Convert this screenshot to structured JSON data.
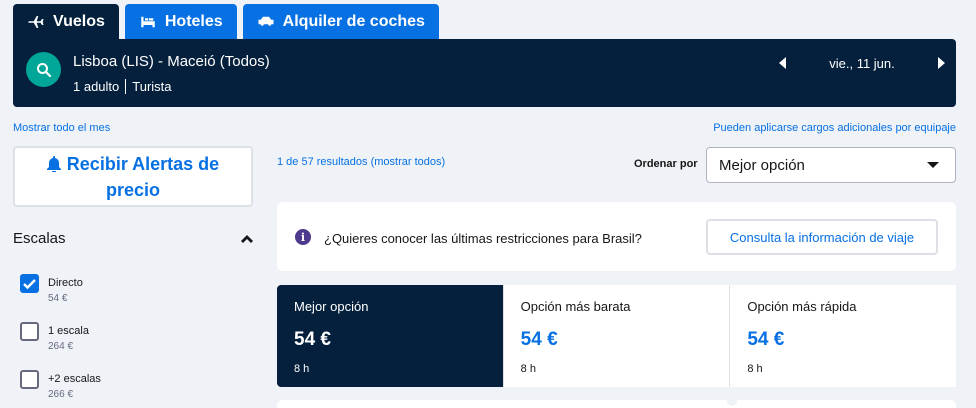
{
  "tabs": [
    {
      "label": "Vuelos",
      "icon": "airplane-icon",
      "active": true
    },
    {
      "label": "Hoteles",
      "icon": "bed-icon",
      "active": false
    },
    {
      "label": "Alquiler de coches",
      "icon": "car-icon",
      "active": false
    }
  ],
  "summary": {
    "route": "Lisboa (LIS) - Maceió (Todos)",
    "passengers": "1 adulto",
    "cabin": "Turista",
    "date": "vie., 11 jun."
  },
  "links": {
    "show_month": "Mostrar todo el mes",
    "baggage_note": "Pueden aplicarse cargos adicionales por equipaje"
  },
  "sidebar": {
    "alert_button": "Recibir Alertas de precio",
    "stops_title": "Escalas",
    "stops": [
      {
        "label": "Directo",
        "price": "54 €",
        "checked": true
      },
      {
        "label": "1 escala",
        "price": "264 €",
        "checked": false
      },
      {
        "label": "+2 escalas",
        "price": "266 €",
        "checked": false
      }
    ]
  },
  "results": {
    "count": "1 de 57 resultados (mostrar todos)",
    "sort_label": "Ordenar por",
    "sort_value": "Mejor opción"
  },
  "banner": {
    "text": "¿Quieres conocer las últimas restricciones para Brasil?",
    "button": "Consulta la información de viaje"
  },
  "sort_tabs": [
    {
      "title": "Mejor opción",
      "price": "54 €",
      "duration": "8 h",
      "active": true
    },
    {
      "title": "Opción más barata",
      "price": "54 €",
      "duration": "8 h",
      "active": false
    },
    {
      "title": "Opción más rápida",
      "price": "54 €",
      "duration": "8 h",
      "active": false
    }
  ],
  "colors": {
    "navy": "#05203c",
    "blue": "#0770e3",
    "teal": "#00a698",
    "background": "#eff3f8"
  }
}
